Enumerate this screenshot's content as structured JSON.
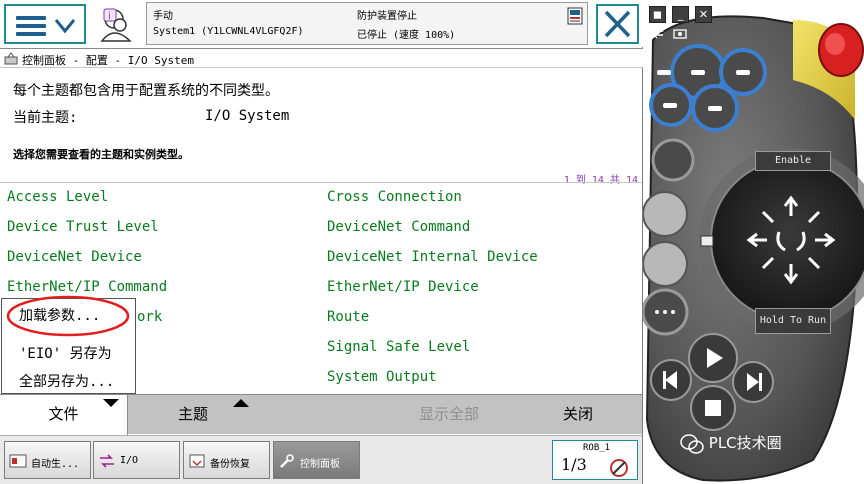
{
  "header": {
    "mode": "手动",
    "system": "System1 (Y1LCWNL4VLGFQ2F)",
    "guard_status": "防护装置停止",
    "run_status": "已停止 (速度 100%)"
  },
  "breadcrumb": "控制面板 - 配置 - I/O System",
  "content": {
    "description": "每个主题都包含用于配置系统的不同类型。",
    "current_topic_label": "当前主题:",
    "current_topic_value": "I/O System",
    "instruction": "选择您需要查看的主题和实例类型。",
    "count": "1 到 14 共 14",
    "topics_left": [
      "Access Level",
      "Device Trust Level",
      "DeviceNet Device",
      "EtherNet/IP Command",
      "Industrial Network",
      "",
      ""
    ],
    "topics_right": [
      "Cross Connection",
      "DeviceNet Command",
      "DeviceNet Internal Device",
      "EtherNet/IP Device",
      "Route",
      "Signal Safe Level",
      "System Output"
    ],
    "visible_left_fragment": "ork"
  },
  "file_menu": {
    "items": [
      "加载参数...",
      "'EIO' 另存为",
      "全部另存为..."
    ]
  },
  "command_bar": {
    "file": "文件",
    "topic": "主题",
    "show_all": "显示全部",
    "close": "关闭"
  },
  "taskbar": {
    "items": [
      "自动生...",
      "I/O",
      "备份恢复",
      "控制面板"
    ],
    "robot_label": "ROB_1",
    "robot_fraction": "1/3"
  },
  "pendant": {
    "enable_label": "Enable",
    "hold_label": "Hold To Run",
    "watermark": "PLC技术圈"
  },
  "colors": {
    "accent_teal": "#1f8a8f",
    "topic_green": "#0a7a1f",
    "count_purple": "#7a3fb2",
    "annotation_red": "#e02020"
  }
}
